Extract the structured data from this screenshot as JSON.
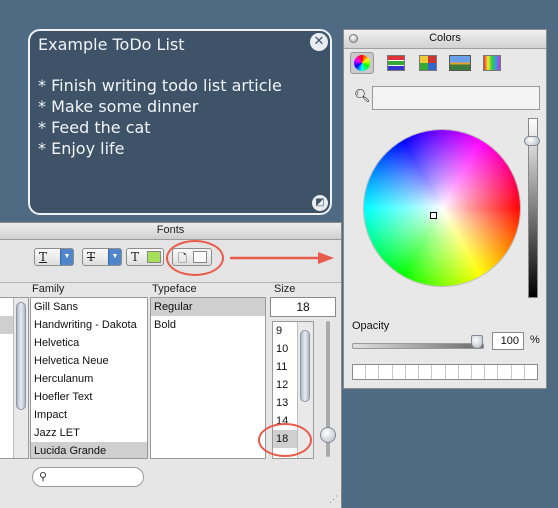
{
  "todo": {
    "title": "Example ToDo List",
    "items": [
      "* Finish writing todo list article",
      "* Make some dinner",
      "* Feed the cat",
      "* Enjoy life"
    ],
    "close_glyph": "✕",
    "resize_glyph": "◩"
  },
  "fonts_panel": {
    "title": "Fonts",
    "toolbar": {
      "underline_glyph": "T",
      "strike_glyph": "T",
      "text_color_glyph": "T",
      "text_color": "#a5e05a",
      "doc_color": "#ffffff"
    },
    "columns": {
      "family": "Family",
      "typeface": "Typeface",
      "size": "Size"
    },
    "families": [
      "Gill Sans",
      "Handwriting - Dakota",
      "Helvetica",
      "Helvetica Neue",
      "Herculanum",
      "Hoefler Text",
      "Impact",
      "Jazz LET",
      "Lucida Grande"
    ],
    "selected_family": "Lucida Grande",
    "typefaces": [
      "Regular",
      "Bold"
    ],
    "selected_typeface": "Regular",
    "size_value": "18",
    "sizes": [
      "9",
      "10",
      "11",
      "12",
      "13",
      "14",
      "18"
    ],
    "selected_size": "18",
    "search_placeholder": ""
  },
  "colors_panel": {
    "title": "Colors",
    "modes": [
      "color-wheel",
      "color-sliders",
      "color-palettes",
      "image-palettes",
      "crayons"
    ],
    "selected_mode": "color-wheel",
    "opacity_label": "Opacity",
    "opacity_value": "100",
    "opacity_unit": "%",
    "annotation_color": "#e85a4a"
  }
}
